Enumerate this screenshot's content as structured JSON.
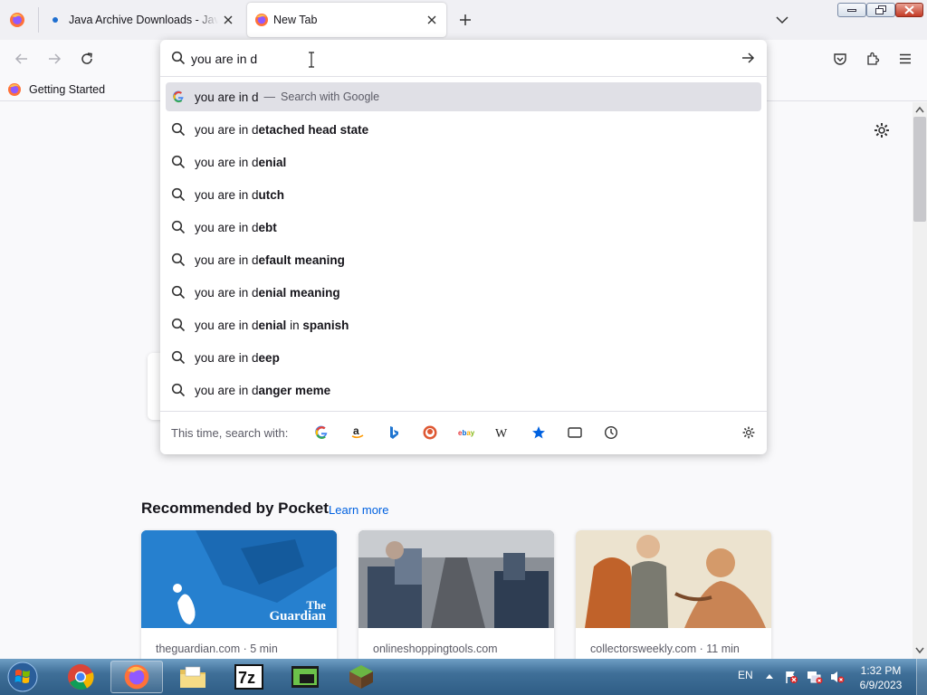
{
  "browser": {
    "tabs": [
      {
        "title": "Java Archive Downloads - Java SE",
        "active": false
      },
      {
        "title": "New Tab",
        "active": true
      }
    ],
    "url_input_value": "you are in d"
  },
  "bookmarks": [
    {
      "label": "Getting Started"
    }
  ],
  "suggestions": {
    "first": {
      "query": "you are in d",
      "separator": "—",
      "action": "Search with Google"
    },
    "items": [
      {
        "typed": "you are in d",
        "completion": "etached head state"
      },
      {
        "typed": "you are in d",
        "completion": "enial"
      },
      {
        "typed": "you are in d",
        "completion": "utch"
      },
      {
        "typed": "you are in d",
        "completion": "ebt"
      },
      {
        "typed": "you are in d",
        "completion": "efault meaning"
      },
      {
        "typed": "you are in d",
        "completion": "enial meaning"
      },
      {
        "typed": "you are in d",
        "completion_a": "enial",
        "middle": " in ",
        "completion_b": "spanish"
      },
      {
        "typed": "you are in d",
        "completion": "eep"
      },
      {
        "typed": "you are in d",
        "completion": "anger meme"
      }
    ],
    "search_with_label": "This time, search with:",
    "engines": [
      "google-icon",
      "amazon-icon",
      "bing-icon",
      "duckduckgo-icon",
      "ebay-icon",
      "wikipedia-icon",
      "bookmarks-icon",
      "tabs-icon",
      "history-icon"
    ]
  },
  "pocket": {
    "heading": "Recommended by Pocket",
    "learn_more": "Learn more",
    "cards": [
      {
        "source": "theguardian.com · 5 min",
        "logo_line1": "The",
        "logo_line2": "Guardian"
      },
      {
        "source": "onlineshoppingtools.com"
      },
      {
        "source": "collectorsweekly.com · 11 min"
      }
    ]
  },
  "taskbar": {
    "language": "EN",
    "time": "1:32 PM",
    "date": "6/9/2023",
    "apps": [
      "start-button",
      "chrome-icon",
      "firefox-icon",
      "explorer-icon",
      "7zip-icon",
      "terminal-icon",
      "minecraft-icon"
    ]
  },
  "colors": {
    "accent": "#0061e0",
    "selected_row": "#e0e0e6",
    "taskbar": "#3f6f98"
  }
}
